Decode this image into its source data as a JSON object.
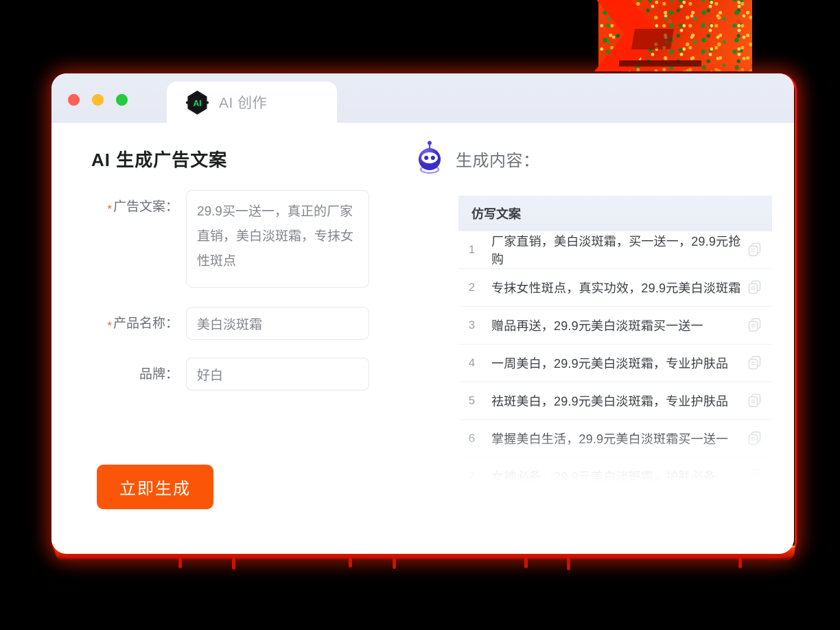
{
  "window": {
    "traffic_lights": [
      {
        "name": "close",
        "color": "#ff5f57"
      },
      {
        "name": "minimize",
        "color": "#febc2e"
      },
      {
        "name": "maximize",
        "color": "#28c840"
      }
    ],
    "tab": {
      "label": "AI 创作",
      "icon": "ai-hexagon-icon",
      "badge_text": "AI"
    }
  },
  "left_panel": {
    "title": "AI 生成广告文案",
    "fields": [
      {
        "label": "广告文案：",
        "required": true,
        "value": "29.9买一送一，真正的厂家直销，美白淡斑霜，专抹女性斑点",
        "type": "textarea"
      },
      {
        "label": "产品名称：",
        "required": true,
        "value": "美白淡斑霜",
        "type": "input"
      },
      {
        "label": "品牌：",
        "required": false,
        "value": "好白",
        "type": "input"
      }
    ],
    "submit_button": {
      "label": "立即生成",
      "color": "#fb5607"
    }
  },
  "right_panel": {
    "title": "生成内容：",
    "icon": "robot-icon",
    "table": {
      "header": "仿写文案",
      "rows": [
        {
          "index": "1",
          "text": "厂家直销，美白淡斑霜，买一送一，29.9元抢购"
        },
        {
          "index": "2",
          "text": "专抹女性斑点，真实功效，29.9元美白淡斑霜"
        },
        {
          "index": "3",
          "text": "赠品再送，29.9元美白淡斑霜买一送一"
        },
        {
          "index": "4",
          "text": "一周美白，29.9元美白淡斑霜，专业护肤品"
        },
        {
          "index": "5",
          "text": "祛斑美白，29.9元美白淡斑霜，专业护肤品"
        },
        {
          "index": "6",
          "text": "掌握美白生活，29.9元美白淡斑霜买一送一"
        },
        {
          "index": "7",
          "text": "女神必备，29.9元美白淡斑霜，护肤必备"
        }
      ],
      "row_action_icon": "copy-icon"
    }
  },
  "theme": {
    "accent_orange": "#fb5607",
    "titlebar_bg": "#e9ecf5",
    "table_header_bg": "#eef1f8",
    "required_star": "#ff5b33",
    "decoration": "red-textured-graphic"
  }
}
